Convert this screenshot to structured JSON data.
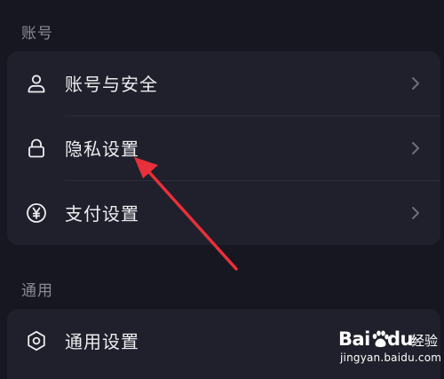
{
  "sections": [
    {
      "title": "账号",
      "items": [
        {
          "label": "账号与安全",
          "icon": "user-icon"
        },
        {
          "label": "隐私设置",
          "icon": "lock-icon"
        },
        {
          "label": "支付设置",
          "icon": "yen-circle-icon"
        }
      ]
    },
    {
      "title": "通用",
      "items": [
        {
          "label": "通用设置",
          "icon": "gear-icon"
        }
      ]
    }
  ],
  "watermark": {
    "brand_part1": "Bai",
    "brand_part2": "du",
    "brand_suffix": "经验",
    "url": "jingyan.baidu.com"
  },
  "colors": {
    "background": "#161721",
    "card": "#1f202b",
    "text": "#ededf0",
    "section_label": "#8a8b94",
    "chevron": "#6e6f79",
    "annotation_arrow": "#e8303a"
  }
}
